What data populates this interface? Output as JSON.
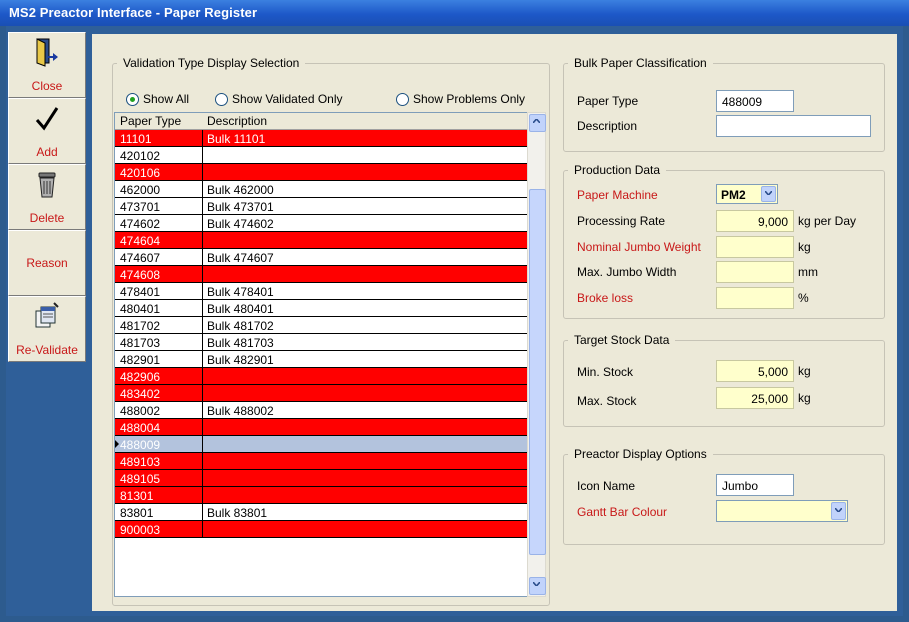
{
  "window": {
    "title": "MS2 Preactor Interface - Paper Register"
  },
  "toolbar": {
    "close_label": "Close",
    "add_label": "Add",
    "delete_label": "Delete",
    "reason_label": "Reason",
    "revalidate_label": "Re-Validate"
  },
  "validation": {
    "legend": "Validation Type Display Selection",
    "options": [
      "Show All",
      "Show Validated Only",
      "Show Problems Only"
    ],
    "selected": "Show All",
    "columns": [
      "Paper Type",
      "Description"
    ],
    "rows": [
      {
        "type": "11101",
        "desc": "Bulk 11101",
        "status": "problem"
      },
      {
        "type": "420102",
        "desc": "",
        "status": "ok"
      },
      {
        "type": "420106",
        "desc": "",
        "status": "problem"
      },
      {
        "type": "462000",
        "desc": "Bulk 462000",
        "status": "ok"
      },
      {
        "type": "473701",
        "desc": "Bulk 473701",
        "status": "ok"
      },
      {
        "type": "474602",
        "desc": "Bulk 474602",
        "status": "ok"
      },
      {
        "type": "474604",
        "desc": "",
        "status": "problem"
      },
      {
        "type": "474607",
        "desc": "Bulk 474607",
        "status": "ok"
      },
      {
        "type": "474608",
        "desc": "",
        "status": "problem"
      },
      {
        "type": "478401",
        "desc": "Bulk 478401",
        "status": "ok"
      },
      {
        "type": "480401",
        "desc": "Bulk 480401",
        "status": "ok"
      },
      {
        "type": "481702",
        "desc": "Bulk 481702",
        "status": "ok"
      },
      {
        "type": "481703",
        "desc": "Bulk 481703",
        "status": "ok"
      },
      {
        "type": "482901",
        "desc": "Bulk 482901",
        "status": "ok"
      },
      {
        "type": "482906",
        "desc": "",
        "status": "problem"
      },
      {
        "type": "483402",
        "desc": "",
        "status": "problem"
      },
      {
        "type": "488002",
        "desc": "Bulk 488002",
        "status": "ok"
      },
      {
        "type": "488004",
        "desc": "",
        "status": "problem"
      },
      {
        "type": "488009",
        "desc": "",
        "status": "selected"
      },
      {
        "type": "489103",
        "desc": "",
        "status": "problem"
      },
      {
        "type": "489105",
        "desc": "",
        "status": "problem"
      },
      {
        "type": "81301",
        "desc": "",
        "status": "problem"
      },
      {
        "type": "83801",
        "desc": "Bulk 83801",
        "status": "ok"
      },
      {
        "type": "900003",
        "desc": "",
        "status": "problem"
      }
    ]
  },
  "classification": {
    "legend": "Bulk Paper Classification",
    "paper_type_label": "Paper Type",
    "paper_type_value": "488009",
    "description_label": "Description",
    "description_value": ""
  },
  "production": {
    "legend": "Production Data",
    "machine_label": "Paper Machine",
    "machine_value": "PM2",
    "rate_label": "Processing Rate",
    "rate_value": "9,000",
    "rate_unit": "kg per Day",
    "jumbo_weight_label": "Nominal Jumbo Weight",
    "jumbo_weight_value": "",
    "jumbo_weight_unit": "kg",
    "jumbo_width_label": "Max. Jumbo Width",
    "jumbo_width_value": "",
    "jumbo_width_unit": "mm",
    "broke_label": "Broke loss",
    "broke_value": "",
    "broke_unit": "%"
  },
  "target_stock": {
    "legend": "Target Stock Data",
    "min_label": "Min. Stock",
    "min_value": "5,000",
    "min_unit": "kg",
    "max_label": "Max. Stock",
    "max_value": "25,000",
    "max_unit": "kg"
  },
  "display_options": {
    "legend": "Preactor Display Options",
    "icon_label": "Icon Name",
    "icon_value": "Jumbo",
    "gantt_label": "Gantt Bar Colour",
    "gantt_value": ""
  },
  "colors": {
    "problem_row": "#ff0000",
    "selected_row": "#b3c3dd",
    "required_label": "#c81818",
    "yellow_field": "#ffffcc"
  }
}
